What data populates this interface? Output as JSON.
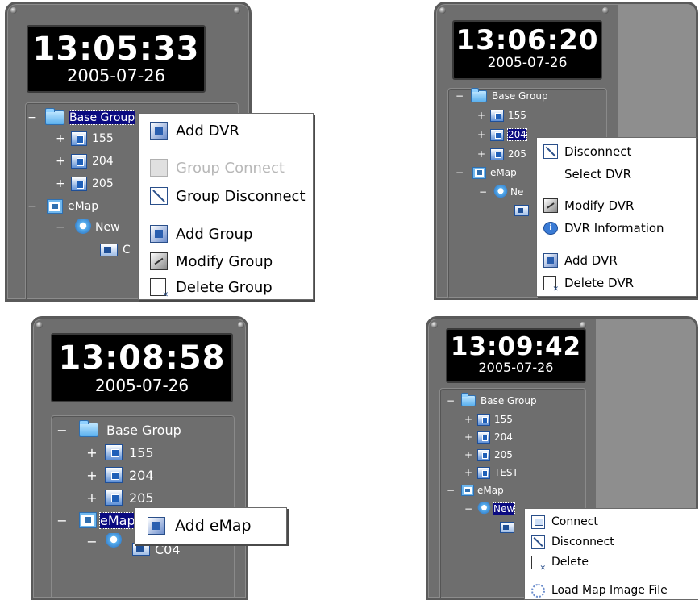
{
  "panels": [
    {
      "time": "13:05:33",
      "date": "2005-07-26",
      "tree": {
        "base_group": "Base Group",
        "dvrs": [
          "155",
          "204",
          "205"
        ],
        "emap": "eMap",
        "map_node": "New",
        "camera": "C"
      },
      "menu": {
        "add_dvr": "Add DVR",
        "group_connect": "Group Connect",
        "group_disconnect": "Group Disconnect",
        "add_group": "Add Group",
        "modify_group": "Modify Group",
        "delete_group": "Delete Group"
      }
    },
    {
      "time": "13:06:20",
      "date": "2005-07-26",
      "tree": {
        "base_group": "Base Group",
        "dvrs": [
          "155",
          "204",
          "205"
        ],
        "emap": "eMap",
        "map_node": "Ne",
        "camera": ""
      },
      "menu": {
        "disconnect": "Disconnect",
        "select_dvr": "Select DVR",
        "modify_dvr": "Modify DVR",
        "dvr_information": "DVR Information",
        "add_dvr": "Add DVR",
        "delete_dvr": "Delete DVR"
      }
    },
    {
      "time": "13:08:58",
      "date": "2005-07-26",
      "tree": {
        "base_group": "Base Group",
        "dvrs": [
          "155",
          "204",
          "205"
        ],
        "emap": "eMap",
        "camera": "C04"
      },
      "menu": {
        "add_emap": "Add eMap"
      }
    },
    {
      "time": "13:09:42",
      "date": "2005-07-26",
      "tree": {
        "base_group": "Base Group",
        "dvrs": [
          "155",
          "204",
          "205",
          "TEST"
        ],
        "emap": "eMap",
        "map_node": "New"
      },
      "menu": {
        "connect": "Connect",
        "disconnect": "Disconnect",
        "delete": "Delete",
        "load_map_image_file": "Load Map Image File"
      }
    }
  ],
  "colors": {
    "panel": "#6e6e6e",
    "selection": "#0a0a80",
    "menu_bg": "#ffffff",
    "disabled_text": "#b8b8b8"
  }
}
